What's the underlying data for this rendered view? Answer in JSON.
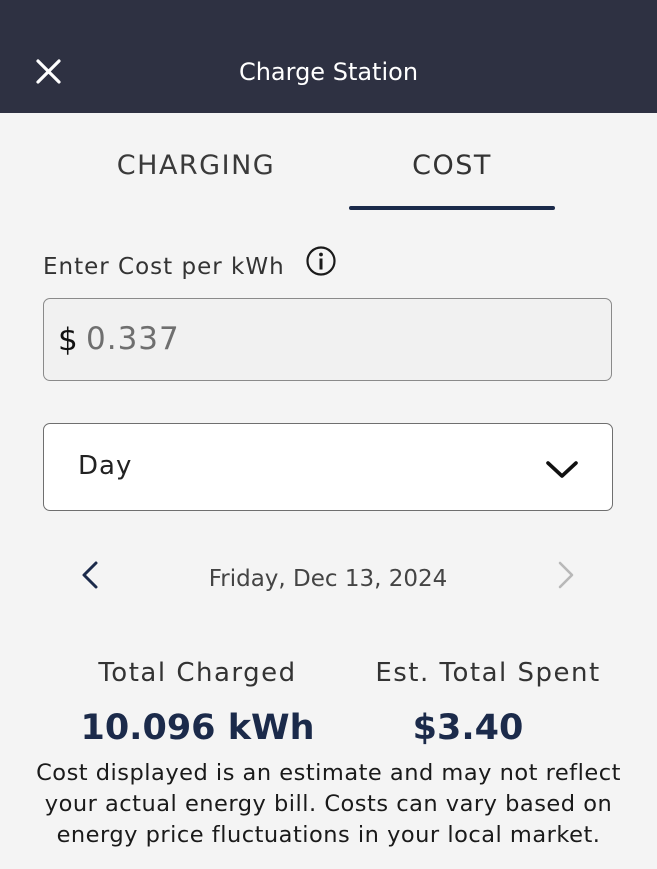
{
  "header": {
    "title": "Charge Station",
    "close_icon": "close-icon"
  },
  "tabs": [
    {
      "label": "CHARGING",
      "active": false
    },
    {
      "label": "COST",
      "active": true
    }
  ],
  "cost_input": {
    "label": "Enter Cost per kWh",
    "currency": "$",
    "value": "0.337",
    "info_icon": "info-icon"
  },
  "period": {
    "selected": "Day",
    "icon": "chevron-down-icon"
  },
  "date_nav": {
    "date": "Friday, Dec 13, 2024",
    "prev_icon": "chevron-left-icon",
    "next_icon": "chevron-right-icon",
    "next_enabled": false
  },
  "stats": {
    "charged_label": "Total Charged",
    "charged_value": "10.096 kWh",
    "spent_label": "Est. Total Spent",
    "spent_value": "$3.40"
  },
  "disclaimer": {
    "line1": "Cost displayed is an estimate and may not reflect",
    "line2": "your actual energy bill. Costs can vary based on",
    "line3": "energy price fluctuations in your local market."
  },
  "colors": {
    "header_bg": "#2e3142",
    "accent": "#1b2a4a",
    "page_bg": "#f4f4f4"
  }
}
